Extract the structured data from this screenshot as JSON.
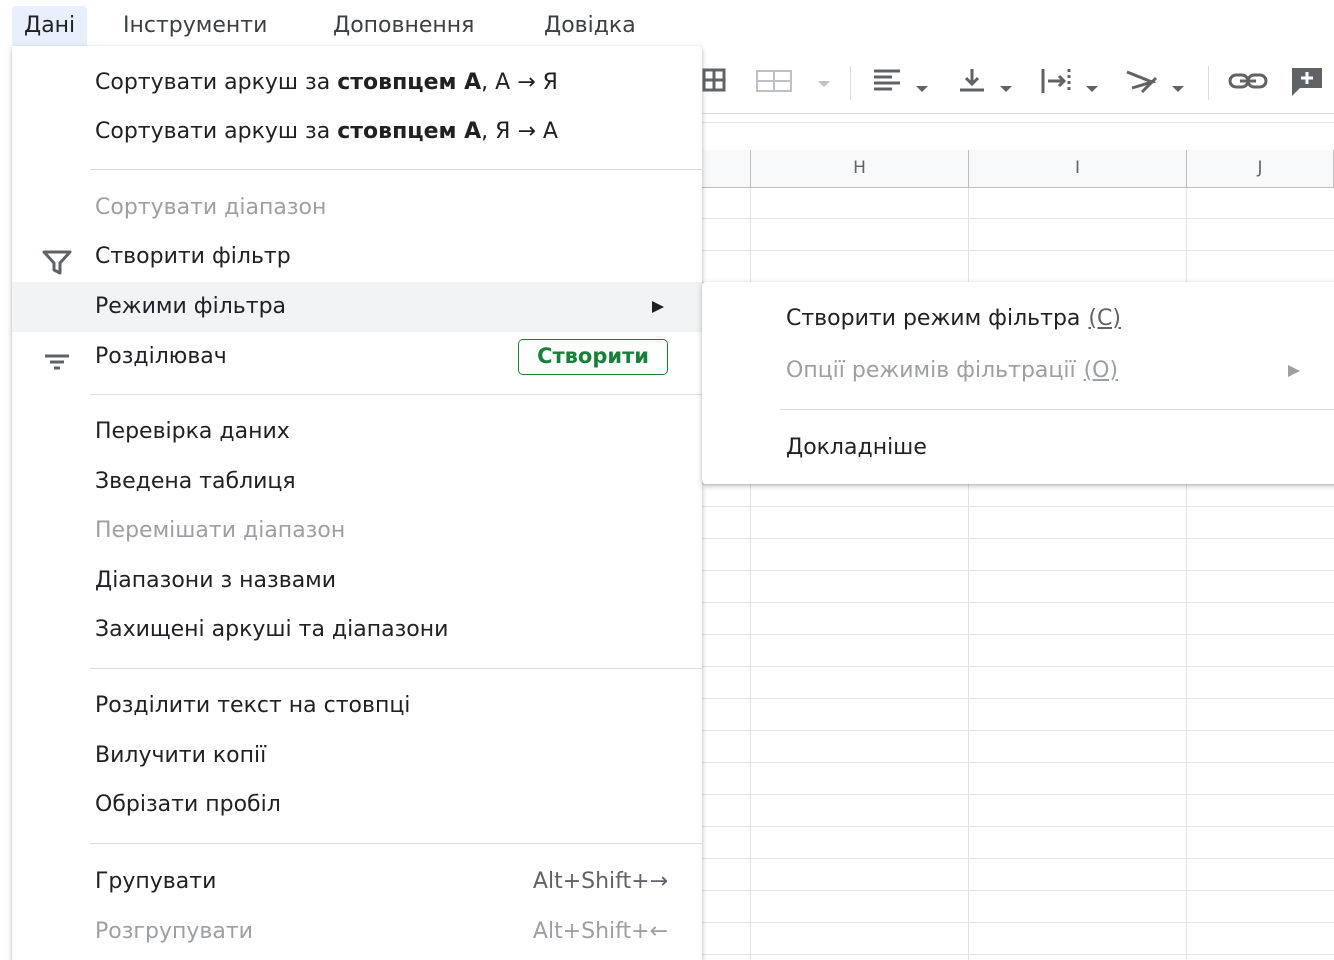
{
  "menubar": {
    "items": [
      "Дані",
      "Інструменти",
      "Доповнення",
      "Довідка"
    ]
  },
  "toolbar": {
    "icons": [
      "borders-icon",
      "merge-cells-icon",
      "align-left-icon",
      "valign-bottom-icon",
      "text-wrap-icon",
      "text-rotate-icon",
      "link-icon",
      "insert-comment-icon"
    ]
  },
  "grid": {
    "columns": [
      "H",
      "I",
      "J"
    ]
  },
  "menu": {
    "sort_asc": {
      "prefix": "Сортувати аркуш за ",
      "bold": "стовпцем А",
      "suffix": ", А → Я"
    },
    "sort_desc": {
      "prefix": "Сортувати аркуш за ",
      "bold": "стовпцем А",
      "suffix": ", Я → А"
    },
    "sort_range": "Сортувати діапазон",
    "create_filter": "Створити фільтр",
    "filter_views": "Режими фільтра",
    "slicer": "Розділювач",
    "slicer_badge": "Створити",
    "data_validation": "Перевірка даних",
    "pivot_table": "Зведена таблиця",
    "randomize_range": "Перемішати діапазон",
    "named_ranges": "Діапазони з назвами",
    "protected_sheets": "Захищені аркуші та діапазони",
    "split_text": "Розділити текст на стовпці",
    "remove_duplicates": "Вилучити копії",
    "trim_whitespace": "Обрізати пробіл",
    "group": "Групувати",
    "group_shortcut": "Alt+Shift+→",
    "ungroup": "Розгрупувати",
    "ungroup_shortcut": "Alt+Shift+←"
  },
  "submenu": {
    "create_filter_view": "Створити режим фільтра",
    "create_filter_view_key": "(С)",
    "filter_view_options": "Опції режимів фільтрації",
    "filter_view_options_key": "(О)",
    "learn_more": "Докладніше"
  },
  "colors": {
    "accent_green": "#188038",
    "disabled_text": "#9aa0a6",
    "active_menu_bg": "#e8f0fe",
    "hover_bg": "#f1f3f4"
  }
}
